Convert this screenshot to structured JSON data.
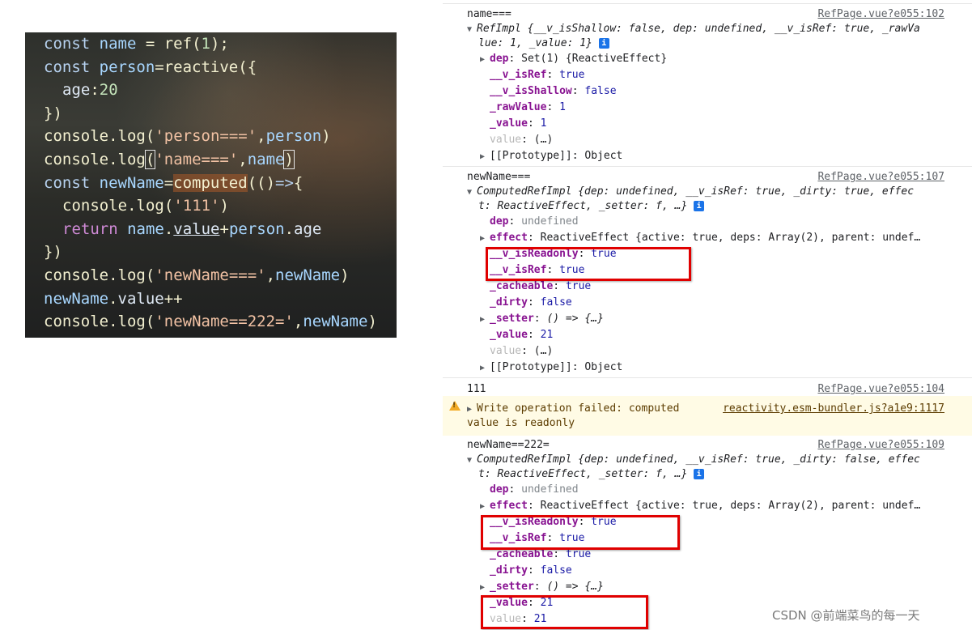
{
  "editor": {
    "lines": [
      {
        "segments": [
          {
            "c": "kw",
            "t": "const "
          },
          {
            "c": "var",
            "t": "name"
          },
          {
            "c": "fn",
            "t": " = "
          },
          {
            "c": "fn",
            "t": "ref"
          },
          {
            "c": "fn",
            "t": "("
          },
          {
            "c": "num",
            "t": "1"
          },
          {
            "c": "fn",
            "t": ");"
          }
        ]
      },
      {
        "segments": [
          {
            "c": "kw",
            "t": "const "
          },
          {
            "c": "var",
            "t": "person"
          },
          {
            "c": "fn",
            "t": "="
          },
          {
            "c": "fn",
            "t": "reactive"
          },
          {
            "c": "fn",
            "t": "({"
          }
        ]
      },
      {
        "indent": true,
        "segments": [
          {
            "c": "prop",
            "t": "age"
          },
          {
            "c": "fn",
            "t": ":"
          },
          {
            "c": "num",
            "t": "20"
          }
        ]
      },
      {
        "segments": [
          {
            "c": "fn",
            "t": "})"
          }
        ]
      },
      {
        "segments": [
          {
            "c": "fn",
            "t": "console"
          },
          {
            "c": "fn",
            "t": "."
          },
          {
            "c": "fn",
            "t": "log"
          },
          {
            "c": "fn",
            "t": "("
          },
          {
            "c": "str",
            "t": "'person==='"
          },
          {
            "c": "fn",
            "t": ","
          },
          {
            "c": "var",
            "t": "person"
          },
          {
            "c": "fn",
            "t": ")"
          }
        ]
      },
      {
        "segments": [
          {
            "c": "fn",
            "t": "console"
          },
          {
            "c": "fn",
            "t": "."
          },
          {
            "c": "fn",
            "t": "log"
          },
          {
            "c": "fn box",
            "t": "("
          },
          {
            "c": "str",
            "t": "'name==='"
          },
          {
            "c": "fn",
            "t": ","
          },
          {
            "c": "var",
            "t": "name"
          },
          {
            "c": "fn box",
            "t": ")"
          }
        ]
      },
      {
        "segments": [
          {
            "c": "kw",
            "t": "const "
          },
          {
            "c": "var",
            "t": "newName"
          },
          {
            "c": "fn",
            "t": "="
          },
          {
            "c": "fn hl",
            "t": "computed"
          },
          {
            "c": "fn",
            "t": "(()"
          },
          {
            "c": "kw",
            "t": "=>"
          },
          {
            "c": "fn",
            "t": "{"
          }
        ]
      },
      {
        "indent": true,
        "segments": [
          {
            "c": "fn",
            "t": "console"
          },
          {
            "c": "fn",
            "t": "."
          },
          {
            "c": "fn",
            "t": "log"
          },
          {
            "c": "fn",
            "t": "("
          },
          {
            "c": "str",
            "t": "'111'"
          },
          {
            "c": "fn",
            "t": ")"
          }
        ]
      },
      {
        "indent": true,
        "segments": [
          {
            "c": "kwr",
            "t": "return "
          },
          {
            "c": "var",
            "t": "name"
          },
          {
            "c": "fn",
            "t": "."
          },
          {
            "c": "prop u",
            "t": "value"
          },
          {
            "c": "fn",
            "t": "+"
          },
          {
            "c": "var",
            "t": "person"
          },
          {
            "c": "fn",
            "t": "."
          },
          {
            "c": "prop",
            "t": "age"
          }
        ]
      },
      {
        "segments": [
          {
            "c": "fn",
            "t": "})"
          }
        ]
      },
      {
        "segments": [
          {
            "c": "fn",
            "t": "console"
          },
          {
            "c": "fn",
            "t": "."
          },
          {
            "c": "fn",
            "t": "log"
          },
          {
            "c": "fn",
            "t": "("
          },
          {
            "c": "str",
            "t": "'newName==='"
          },
          {
            "c": "fn",
            "t": ","
          },
          {
            "c": "var",
            "t": "newName"
          },
          {
            "c": "fn",
            "t": ")"
          }
        ]
      },
      {
        "segments": [
          {
            "c": "var",
            "t": "newName"
          },
          {
            "c": "fn",
            "t": "."
          },
          {
            "c": "prop",
            "t": "value"
          },
          {
            "c": "fn",
            "t": "++"
          }
        ]
      },
      {
        "segments": [
          {
            "c": "fn",
            "t": "console"
          },
          {
            "c": "fn",
            "t": "."
          },
          {
            "c": "fn",
            "t": "log"
          },
          {
            "c": "fn",
            "t": "("
          },
          {
            "c": "str",
            "t": "'newName==222='"
          },
          {
            "c": "fn",
            "t": ","
          },
          {
            "c": "var",
            "t": "newName"
          },
          {
            "c": "fn",
            "t": ")"
          }
        ]
      }
    ]
  },
  "console": {
    "g1": {
      "label": "name===",
      "source": "RefPage.vue?e055:102",
      "summary1": "RefImpl {__v_isShallow: false, dep: undefined, __v_isRef: true, _rawVa",
      "summary2": "lue: 1, _value: 1}",
      "dep": {
        "k": "dep",
        "v": "Set(1) {ReactiveEffect}"
      },
      "isRef": {
        "k": "__v_isRef",
        "v": "true"
      },
      "isShallow": {
        "k": "__v_isShallow",
        "v": "false"
      },
      "rawValue": {
        "k": "_rawValue",
        "v": "1"
      },
      "value_": {
        "k": "_value",
        "v": "1"
      },
      "value": {
        "k": "value",
        "v": "(…)"
      },
      "proto": "[[Prototype]]: Object"
    },
    "g2": {
      "label": "newName===",
      "source": "RefPage.vue?e055:107",
      "summary1": "ComputedRefImpl {dep: undefined, __v_isRef: true, _dirty: true, effec",
      "summary2": "t: ReactiveEffect, _setter: f, …}",
      "dep": {
        "k": "dep",
        "v": "undefined"
      },
      "effect": {
        "k": "effect",
        "v": "ReactiveEffect {active: true, deps: Array(2), parent: undef…"
      },
      "isReadonly": {
        "k": "__v_isReadonly",
        "v": "true"
      },
      "isRef": {
        "k": "__v_isRef",
        "v": "true"
      },
      "cacheable": {
        "k": "_cacheable",
        "v": "true"
      },
      "dirty": {
        "k": "_dirty",
        "v": "false"
      },
      "setter": {
        "k": "_setter",
        "v": "() => {…}"
      },
      "value_": {
        "k": "_value",
        "v": "21"
      },
      "value": {
        "k": "value",
        "v": "(…)"
      },
      "proto": "[[Prototype]]: Object"
    },
    "g3": {
      "label": "111",
      "source": "RefPage.vue?e055:104"
    },
    "warn": {
      "line1": "Write operation failed: computed",
      "line2": "value is readonly",
      "source": "reactivity.esm-bundler.js?a1e9:1117"
    },
    "g4": {
      "label": "newName==222=",
      "source": "RefPage.vue?e055:109",
      "summary1": "ComputedRefImpl {dep: undefined, __v_isRef: true, _dirty: false, effec",
      "summary2": "t: ReactiveEffect, _setter: f, …}",
      "dep": {
        "k": "dep",
        "v": "undefined"
      },
      "effect": {
        "k": "effect",
        "v": "ReactiveEffect {active: true, deps: Array(2), parent: undef…"
      },
      "isReadonly": {
        "k": "__v_isReadonly",
        "v": "true"
      },
      "isRef": {
        "k": "__v_isRef",
        "v": "true"
      },
      "cacheable": {
        "k": "_cacheable",
        "v": "true"
      },
      "dirty": {
        "k": "_dirty",
        "v": "false"
      },
      "setter": {
        "k": "_setter",
        "v": "() => {…}"
      },
      "value_": {
        "k": "_value",
        "v": "21"
      },
      "value": {
        "k": "value",
        "v": "21"
      }
    }
  },
  "watermark": "CSDN @前端菜鸟的每一天",
  "colors": {
    "highlight_box": "#e00000",
    "warning_bg": "#fffbe5",
    "key": "#881391",
    "value": "#1a1aa6"
  }
}
